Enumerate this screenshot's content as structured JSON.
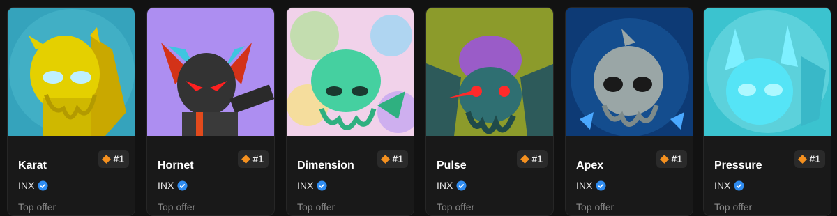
{
  "cards": [
    {
      "name": "Karat",
      "rank": "#1",
      "collection": "INX",
      "offer_label": "Top offer",
      "art": "yellow-cthulhu",
      "bg": "#38a7c0"
    },
    {
      "name": "Hornet",
      "rank": "#1",
      "collection": "INX",
      "offer_label": "Top offer",
      "art": "armored-cthulhu",
      "bg": "#ae8ef2"
    },
    {
      "name": "Dimension",
      "rank": "#1",
      "collection": "INX",
      "offer_label": "Top offer",
      "art": "green-cthulhu",
      "bg": "#f2c9e6"
    },
    {
      "name": "Pulse",
      "rank": "#1",
      "collection": "INX",
      "offer_label": "Top offer",
      "art": "brain-cthulhu",
      "bg": "#8b9a2a"
    },
    {
      "name": "Apex",
      "rank": "#1",
      "collection": "INX",
      "offer_label": "Top offer",
      "art": "grey-cthulhu",
      "bg": "#0e3a73"
    },
    {
      "name": "Pressure",
      "rank": "#1",
      "collection": "INX",
      "offer_label": "Top offer",
      "art": "ice-cthulhu",
      "bg": "#3ec4d0"
    }
  ],
  "colors": {
    "rank_accent": "#f4901f",
    "verified": "#2f8cf0",
    "page_bg": "#121212"
  }
}
